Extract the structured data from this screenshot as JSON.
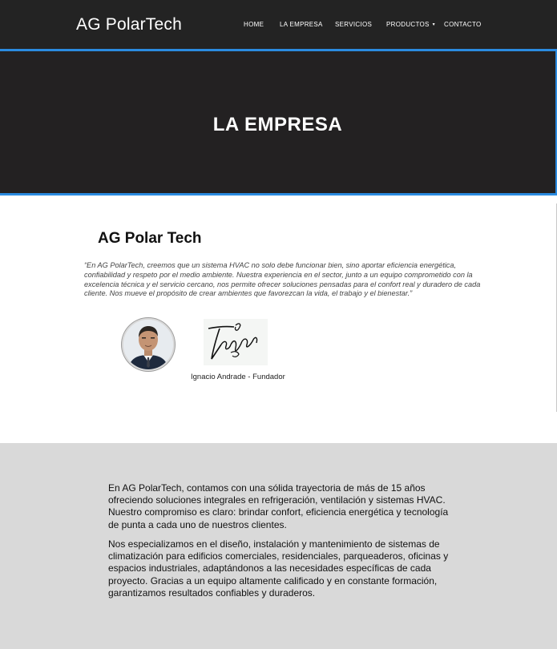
{
  "nav": {
    "brand": "AG PolarTech",
    "items": [
      {
        "label": "HOME"
      },
      {
        "label": "LA EMPRESA"
      },
      {
        "label": "SERVICIOS"
      },
      {
        "label": "PRODUCTOS"
      },
      {
        "label": "CONTACTO"
      }
    ],
    "dropdown_glyph": "▾"
  },
  "hero": {
    "title": "LA EMPRESA"
  },
  "about": {
    "title": "AG Polar Tech",
    "quote": "“En AG PolarTech, creemos que un sistema HVAC no solo debe funcionar bien, sino aportar eficiencia energética, confiabilidad y respeto por el medio ambiente. Nuestra experiencia en el sector, junto a un equipo comprometido con la excelencia técnica y el servicio cercano, nos permite ofrecer soluciones pensadas para el confort real y duradero de cada cliente. Nos mueve el propósito de crear ambientes que favorezcan la vida, el trabajo y el bienestar.”",
    "founder_caption": "Ignacio Andrade - Fundador"
  },
  "info": {
    "paragraph_1": "En AG PolarTech, contamos con una sólida trayectoria de más de 15 años ofreciendo soluciones integrales en refrigeración, ventilación y sistemas HVAC. Nuestro compromiso es claro: brindar confort, eficiencia energética y tecnología de punta a cada uno de nuestros clientes.",
    "paragraph_2": "Nos especializamos en el diseño, instalación y mantenimiento de sistemas de climatización para edificios comerciales, residenciales, parqueaderos, oficinas y espacios industriales, adaptándonos a las necesidades específicas de cada proyecto. Gracias a un equipo altamente calificado y en constante formación, garantizamos resultados confiables y duraderos."
  },
  "colors": {
    "nav_bg": "#232323",
    "hero_bg": "#232122",
    "accent_border": "#2b8be0",
    "info_bg": "#d9d9d9"
  }
}
